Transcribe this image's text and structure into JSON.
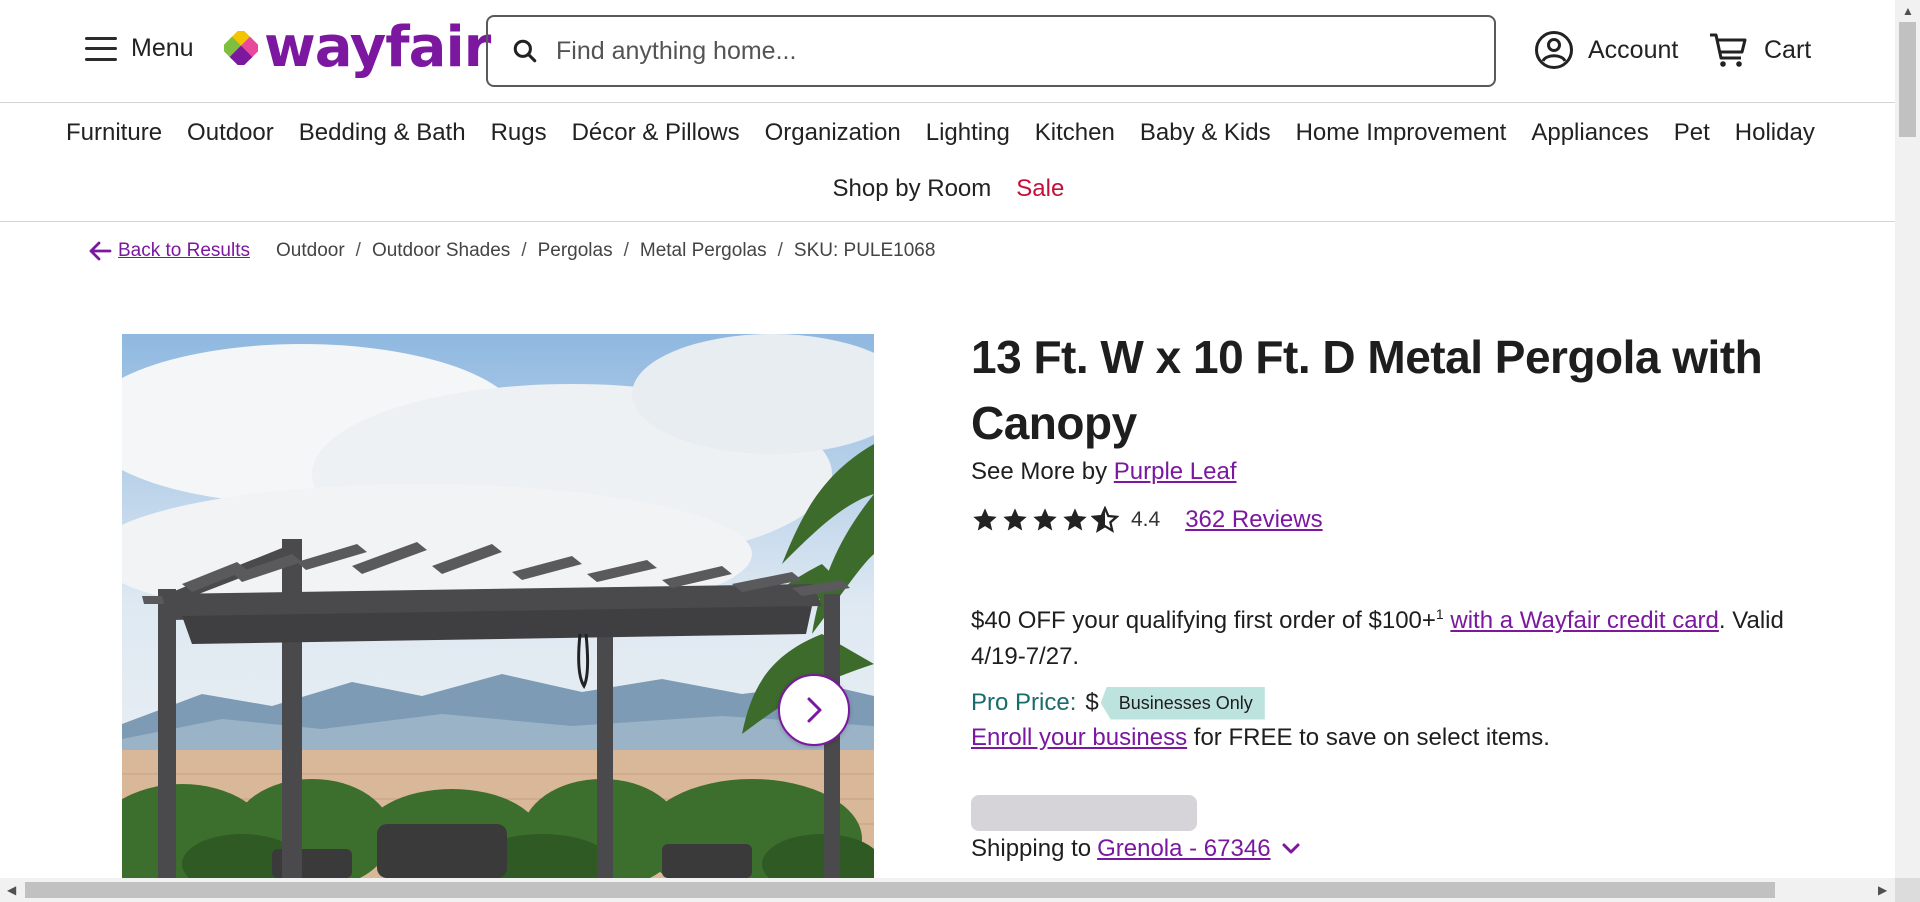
{
  "header": {
    "menu_label": "Menu",
    "logo_text": "wayfair",
    "search_placeholder": "Find anything home...",
    "account_label": "Account",
    "cart_label": "Cart"
  },
  "nav": {
    "row1": [
      "Furniture",
      "Outdoor",
      "Bedding & Bath",
      "Rugs",
      "Décor & Pillows",
      "Organization",
      "Lighting",
      "Kitchen",
      "Baby & Kids",
      "Home Improvement",
      "Appliances",
      "Pet",
      "Holiday"
    ],
    "row2": [
      "Shop by Room"
    ],
    "sale_label": "Sale"
  },
  "breadcrumb": {
    "back_label": "Back to Results",
    "items": [
      "Outdoor",
      "Outdoor Shades",
      "Pergolas",
      "Metal Pergolas"
    ],
    "sku": "SKU: PULE1068"
  },
  "product": {
    "title": "13 Ft. W x 10 Ft. D Metal Pergola with Canopy",
    "see_more_prefix": "See More by",
    "brand": "Purple Leaf",
    "rating_value": "4.4",
    "rating_numeric": 4.4,
    "reviews_label": "362 Reviews",
    "promo_text_1": "$40 OFF your qualifying first order of $100+",
    "promo_sup": "1",
    "promo_link": "with a Wayfair credit card",
    "promo_text_2": ". Valid 4/19-7/27.",
    "pro_price_label": "Pro Price:",
    "pro_price_value": "$",
    "pro_badge": "Businesses Only",
    "enroll_link": "Enroll your business",
    "enroll_text": "for FREE to save on select items.",
    "shipping_prefix": "Shipping to",
    "shipping_location": "Grenola - 67346"
  },
  "colors": {
    "brand_purple": "#7b189f",
    "sale_red": "#c2103a",
    "pro_teal": "#1a6b6b",
    "badge_bg": "#bde3df"
  }
}
